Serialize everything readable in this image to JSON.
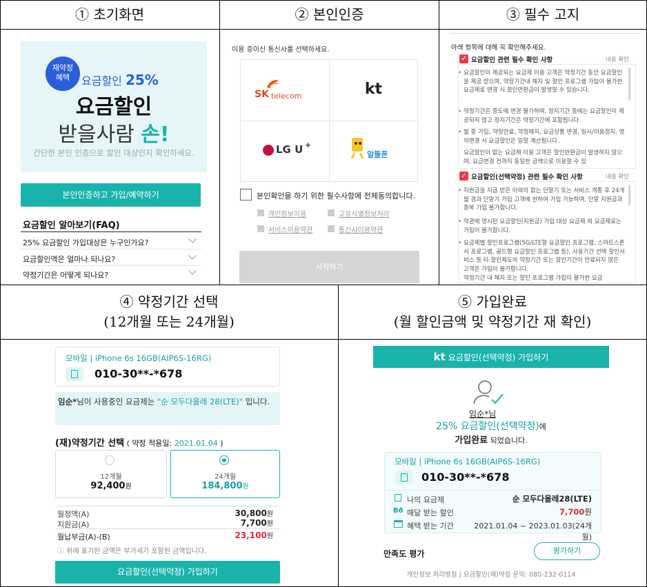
{
  "headers": {
    "h1": "① 초기화면",
    "h2": "② 본인인증",
    "h3": "③ 필수 고지",
    "h4a": "④ 약정기간 선택",
    "h4b": "(12개월 또는 24개월)",
    "h5a": "⑤ 가입완료",
    "h5b": "(월 할인금액 및 약정기간 재 확인)"
  },
  "p1": {
    "badge": "재약정\n혜택",
    "line1_prefix": "요금할인 ",
    "line1_pct": "25%",
    "line2": "요금할인",
    "line3": "받을사람 ",
    "line3_accent": "손!",
    "desc": "간단한 본인 인증으로 할인 대상인지 확인하세요.",
    "btn": "본인인증하고 가입/예약하기",
    "faq_title": "요금할인 알아보기(FAQ)",
    "faq": [
      "25% 요금할인 가입대상은 누구인가요?",
      "요금할인액은 얼마나 되나요?",
      "약정기간은 어떻게 되나요?"
    ]
  },
  "p2": {
    "prompt": "이용 중이신 통신사를 선택하세요.",
    "carriers": {
      "skt": "SK",
      "skt2": "telecom",
      "kt": "kt",
      "lgu": "LG U",
      "lgu_plus": "+",
      "alddle": "알뜰폰"
    },
    "agree": "본인확인을 하기 위한 필수사항에 전체동의합니다.",
    "terms": [
      "개인정보이용",
      "고유식별정보처리",
      "서비스이용약관",
      "통신사이용약관"
    ],
    "start": "시작하기"
  },
  "p3": {
    "intro": "아래 항목에 대해 꼭 확인해주세요.",
    "sec1": "요금할인 관련 필수 확인 사항",
    "sec2": "요금할인(선택약정) 관련 필수 확인 사항",
    "more": "내용 확인",
    "b1": [
      "요금할인이 제공되는 요금제 이용 고객은 약정기간 동안 요금할인을 제공 받으며, 약정기간내 해지 및 할인 프로그램 가입이 불가한 요금제로 변경 시 할인반환금이 발생할 수 있습니다.",
      "약정기간은 중도에 변경 불가하며, 정지기간 중에는 요금할인이 제공되지 않고 정지기간은 약정기간에 포함됩니다.",
      "월 중 가입, 약정만료, 약정해지, 요금상품 변경, 일시/이용정지, 명의변경 시 요금할인은 일할 계산됩니다.",
      "요금할인이 없는 요금제 이용 고객은 할인반환금이 발생하지 않으며, 요금변경 전까지 동일한 금액으로 이용할 수 있"
    ],
    "b2": [
      "지원금을 지급 받은 이력이 없는 단말기 또는 서비스 개통 후 24개월 경과 단말기 가입 고객에 한하여 가입 가능하며, 단말 지원금과 중복 가입 불가합니다.",
      "약관에 명시된 요금할인(지원금) 가입 대상 요금제 외 요금제로는 가입이 불가합니다.",
      "요금제별 할인프로그램(5G/LTE형 요금할인 프로그램, 스마트스폰서 프로그램, 골드형 요금할인 프로그램 등), 사용기간 선택 할인서비스 등 타 할인제도의 약정기간 또는 할인기간이 만료되지 않은 고객은 가입이 불가합니다.",
      "약정기간 내 해지 또는 할인 프로그램 가입이 불가한 요금"
    ]
  },
  "p4": {
    "device": "모바일 | iPhone 6s 16GB(AIP6S-16RG)",
    "phone": "010-30**-*678",
    "user": "임순*",
    "user_mid": "님이 사용중인 요금제는 ",
    "plan": "\"순 모두다올레 28(LTE)\"",
    "user_end": " 입니다.",
    "sel_title": "(재)약정기간 선택",
    "sel_sub": " ( 약정 적용일: ",
    "sel_date": "2021.01.04",
    "sel_close": " )",
    "opt12": "12개월",
    "opt12_amt": "92,400",
    "opt24": "24개월",
    "opt24_amt": "184,800",
    "won": "원",
    "rows": [
      {
        "k": "월정액(A)",
        "v": "30,800"
      },
      {
        "k": "지원금(A)",
        "v": "7,700"
      },
      {
        "k": "월납부금(A)-(B)",
        "v": "23,100"
      }
    ],
    "note": "ⓘ 위에 표기된 금액은 부가세가 포함된 금액입니다.",
    "btn": "요금할인(선택약정) 가입하기"
  },
  "p5": {
    "bar_kt": "kt",
    "bar": "요금할인(선택약정) 가입하기",
    "user": "임순*님",
    "done1": "25% 요금할인(선택약정)",
    "done1b": "에",
    "done2": "가입완료",
    "done2b": " 되었습니다.",
    "device": "모바일 | iPhone 6s 16GB(AIP6S-16RG)",
    "phone": "010-30**-*678",
    "r1k": "나의 요금제",
    "r1v": "순 모두다올레28(LTE)",
    "r2k": "매달 받는 할인",
    "r2v": "7,700",
    "r2u": "원",
    "r3k": "혜택 받는 기간",
    "r3v": "2021.01.04 ~ 2023.01.03(24개월)",
    "survey": "만족도 평가",
    "survey_btn": "평가하기",
    "footer": "개인정보 처리방침 | 요금할인(재)약정 문의: 080-232-0114"
  },
  "colors": {
    "teal": "#1ab3ab",
    "red": "#e0263a",
    "blue": "#2b6fd6"
  }
}
